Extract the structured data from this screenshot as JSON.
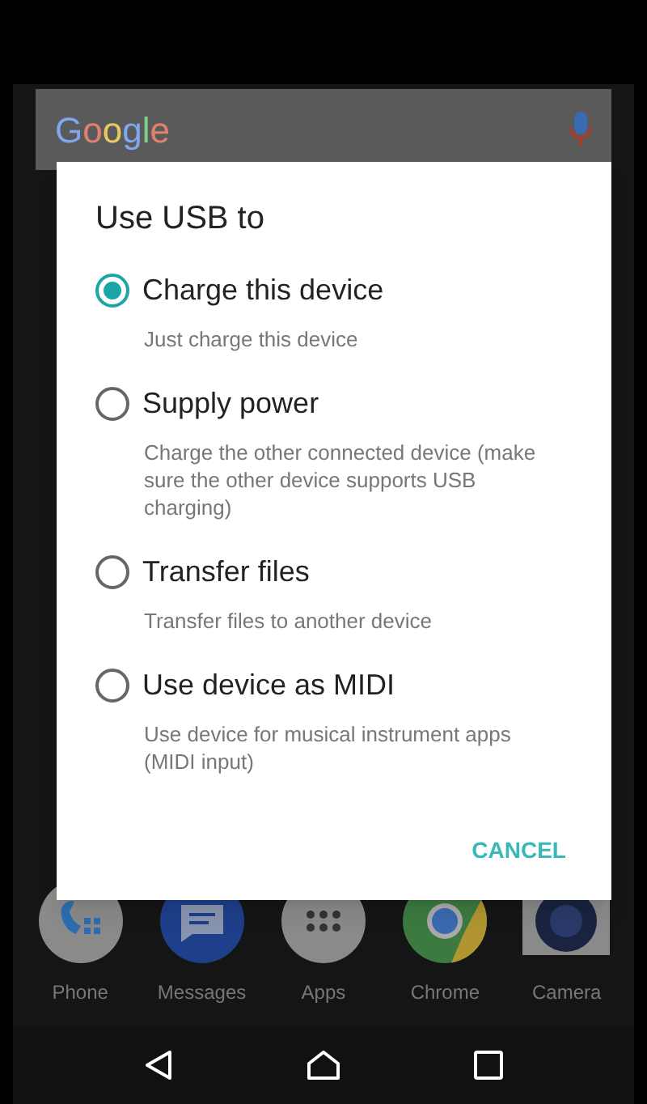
{
  "search_bar": {
    "logo": "Google"
  },
  "dialog": {
    "title": "Use USB to",
    "options": [
      {
        "label": "Charge this device",
        "description": "Just charge this device",
        "selected": true
      },
      {
        "label": "Supply power",
        "description": "Charge the other connected device (make sure the other device supports USB charging)",
        "selected": false
      },
      {
        "label": "Transfer files",
        "description": "Transfer files to another device",
        "selected": false
      },
      {
        "label": "Use device as MIDI",
        "description": "Use device for musical instrument apps (MIDI input)",
        "selected": false
      }
    ],
    "button": "CANCEL"
  },
  "dock": [
    {
      "label": "Phone",
      "kind": "phone"
    },
    {
      "label": "Messages",
      "kind": "messages"
    },
    {
      "label": "Apps",
      "kind": "apps"
    },
    {
      "label": "Chrome",
      "kind": "chrome"
    },
    {
      "label": "Camera",
      "kind": "camera"
    }
  ]
}
